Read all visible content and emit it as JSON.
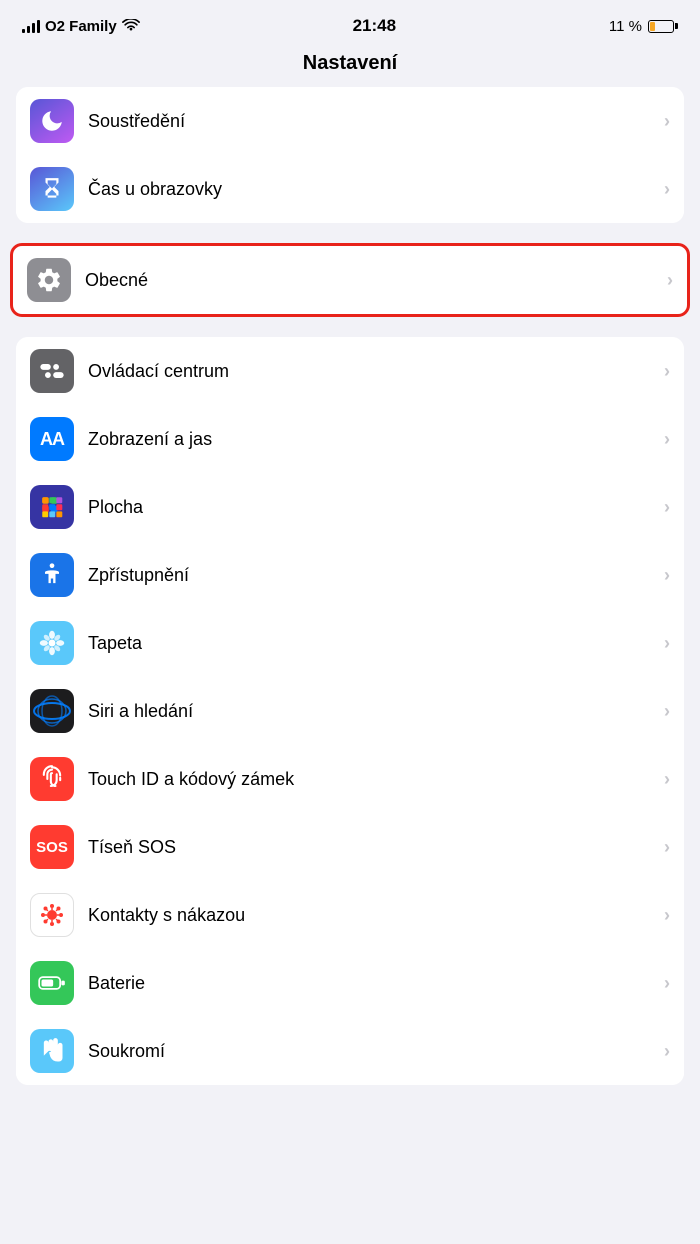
{
  "statusBar": {
    "carrier": "O2 Family",
    "wifi": true,
    "time": "21:48",
    "battery": "11 %"
  },
  "pageTitle": "Nastavení",
  "sections": [
    {
      "id": "top",
      "items": [
        {
          "id": "soustredeni",
          "label": "Soustředění",
          "iconType": "moon",
          "iconBg": "focus"
        },
        {
          "id": "casObrazovky",
          "label": "Čas u obrazovky",
          "iconType": "screentime",
          "iconBg": "screentime"
        }
      ]
    },
    {
      "id": "general",
      "highlighted": true,
      "items": [
        {
          "id": "obecne",
          "label": "Obecné",
          "iconType": "gear",
          "iconBg": "gray"
        }
      ]
    },
    {
      "id": "display",
      "items": [
        {
          "id": "ovladaciCentrum",
          "label": "Ovládací centrum",
          "iconType": "toggle",
          "iconBg": "gray2"
        },
        {
          "id": "zobrazeni",
          "label": "Zobrazení a jas",
          "iconType": "aa",
          "iconBg": "blue"
        },
        {
          "id": "plocha",
          "label": "Plocha",
          "iconType": "grid",
          "iconBg": "indigo"
        },
        {
          "id": "zpristupneni",
          "label": "Zpřístupnění",
          "iconType": "accessibility",
          "iconBg": "blue2"
        },
        {
          "id": "tapeta",
          "label": "Tapeta",
          "iconType": "flower",
          "iconBg": "blue3"
        },
        {
          "id": "siri",
          "label": "Siri a hledání",
          "iconType": "siri",
          "iconBg": "dark"
        },
        {
          "id": "touchid",
          "label": "Touch ID a kódový zámek",
          "iconType": "fingerprint",
          "iconBg": "red"
        },
        {
          "id": "tisenSos",
          "label": "Tíseň SOS",
          "iconType": "sos",
          "iconBg": "red2"
        },
        {
          "id": "nakazou",
          "label": "Kontakty s nákazou",
          "iconType": "virus",
          "iconBg": "white"
        },
        {
          "id": "baterie",
          "label": "Baterie",
          "iconType": "battery",
          "iconBg": "green"
        },
        {
          "id": "soukromi",
          "label": "Soukromí",
          "iconType": "hand",
          "iconBg": "blue4"
        }
      ]
    }
  ]
}
